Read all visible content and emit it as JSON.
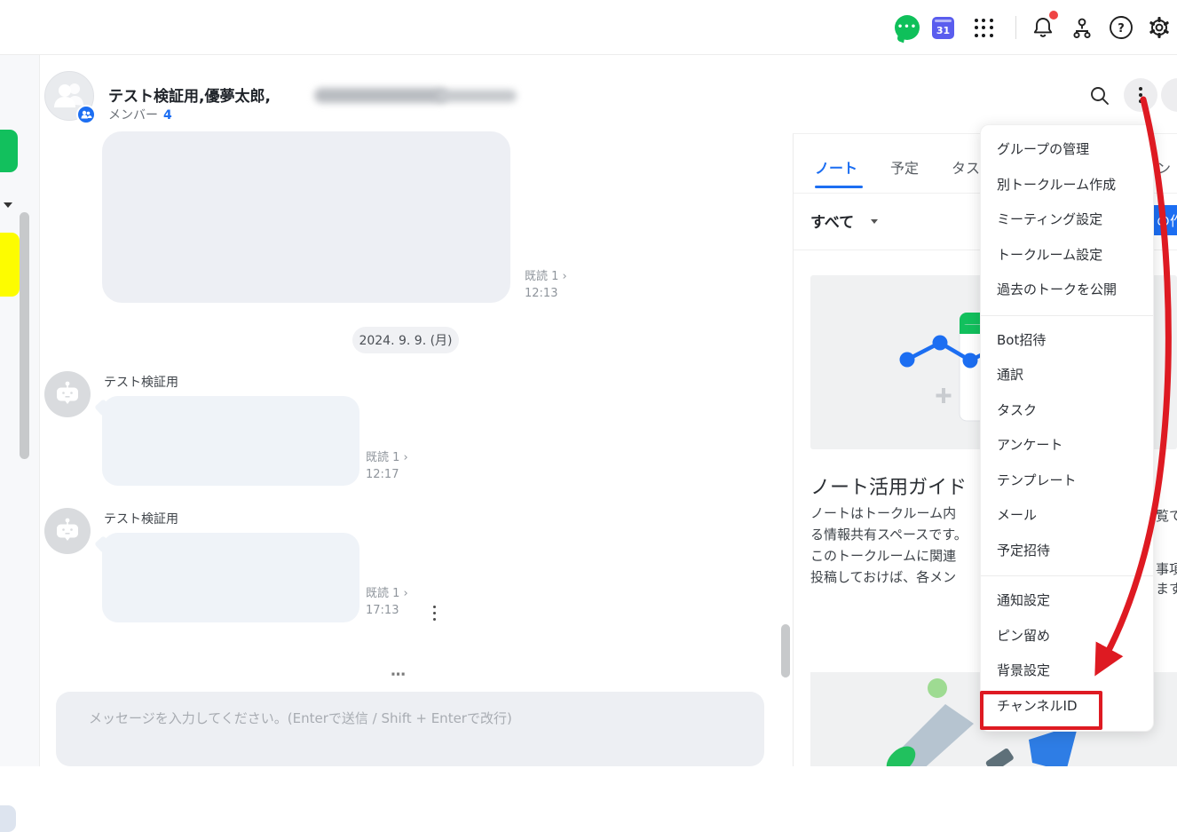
{
  "colors": {
    "accent_blue": "#1c6ef2",
    "brand_green": "#0fc05a",
    "annotation_red": "#de1a22",
    "calendar_purple": "#5a5dee",
    "notification_red": "#ef4444"
  },
  "topbar": {
    "calendar_day": "31"
  },
  "header": {
    "title": "テスト検証用,優夢太郎,",
    "member_label": "メンバー",
    "member_count": "4"
  },
  "chat": {
    "date_divider": "2024. 9. 9. (月)",
    "message1": {
      "read": "既読 1 ›",
      "time": "12:13"
    },
    "bot1": {
      "sender": "テスト検証用",
      "read": "既読 1 ›",
      "time": "12:17"
    },
    "bot2": {
      "sender": "テスト検証用",
      "read": "既読 1 ›",
      "time": "17:13"
    },
    "more_indicator": "⋯",
    "input_placeholder": "メッセージを入力してください。(Enterで送信 / Shift + Enterで改行)"
  },
  "panel": {
    "tabs": [
      "ノート",
      "予定",
      "タスク"
    ],
    "hidden_tab_fragment": "ン",
    "filter_label": "すべて",
    "create_button_fragment": "の作",
    "guide_title": "ノート活用ガイド",
    "guide_lines": [
      "ノートはトークルーム内",
      "る情報共有スペースです。",
      "このトークルームに関連",
      "投稿しておけば、各メン"
    ],
    "guide_fragments": [
      "覧て",
      "事項",
      "ます"
    ]
  },
  "menu": {
    "group1": [
      "グループの管理",
      "別トークルーム作成",
      "ミーティング設定",
      "トークルーム設定",
      "過去のトークを公開"
    ],
    "group2": [
      "Bot招待",
      "通訳",
      "タスク",
      "アンケート",
      "テンプレート",
      "メール",
      "予定招待"
    ],
    "group3": [
      "通知設定",
      "ピン留め",
      "背景設定",
      "チャンネルID"
    ]
  }
}
